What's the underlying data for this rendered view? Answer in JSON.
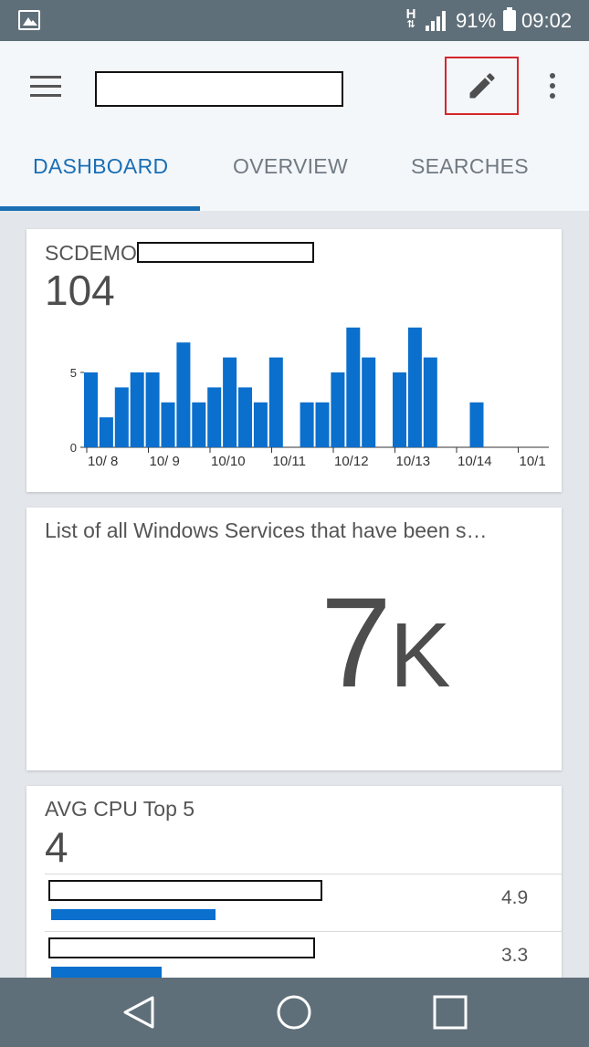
{
  "status_bar": {
    "network_label": "H",
    "battery_text": "91%",
    "clock": "09:02"
  },
  "app_bar": {
    "tabs": [
      {
        "label": "DASHBOARD"
      },
      {
        "label": "OVERVIEW"
      },
      {
        "label": "SEARCHES"
      }
    ],
    "accent_color": "#1a6fb5",
    "edit_highlight_color": "#d6262b"
  },
  "cards": {
    "scdemo": {
      "title": "SCDEMO",
      "value": "104",
      "chart_data": {
        "type": "bar",
        "yticks": [
          0,
          5
        ],
        "ylim": [
          0,
          8
        ],
        "x_tick_labels": [
          "10/ 8",
          "10/ 9",
          "10/10",
          "10/11",
          "10/12",
          "10/13",
          "10/14",
          "10/1"
        ],
        "bar_color": "#0a6fcd",
        "values": [
          5,
          2,
          4,
          5,
          5,
          3,
          7,
          3,
          4,
          6,
          4,
          3,
          6,
          0,
          3,
          3,
          5,
          8,
          6,
          0,
          5,
          8,
          6,
          0,
          0,
          3,
          0,
          0
        ]
      }
    },
    "windows_services": {
      "title": "List of all Windows Services that have been s…",
      "value_number": "7",
      "value_suffix": "K"
    },
    "avg_cpu": {
      "title": "AVG CPU Top 5",
      "value": "4",
      "rows": [
        {
          "value": "4.9",
          "fraction": 0.49
        },
        {
          "value": "3.3",
          "fraction": 0.33
        }
      ]
    }
  },
  "nav_bar": {
    "buttons": [
      "back",
      "home",
      "recents"
    ]
  }
}
